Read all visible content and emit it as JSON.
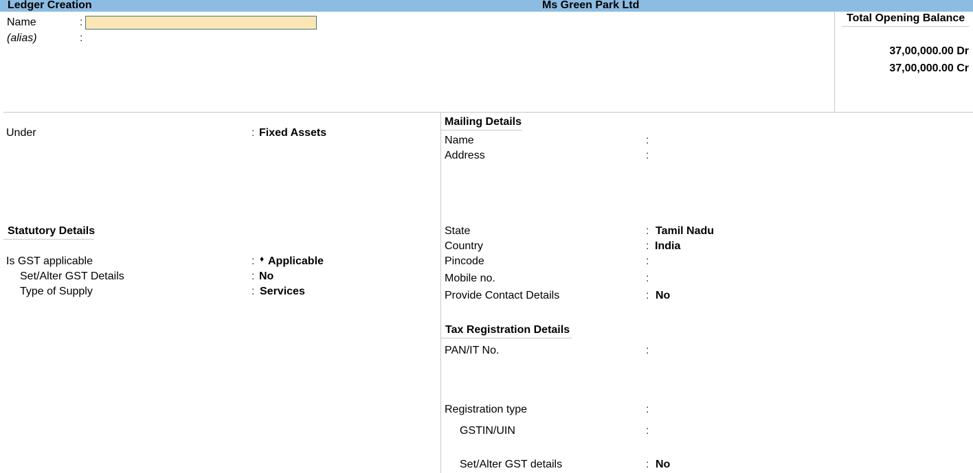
{
  "header": {
    "screen_title": "Ledger Creation",
    "company_name": "Ms Green Park Ltd"
  },
  "top": {
    "name_label": "Name",
    "name_value": "",
    "alias_label": "(alias)"
  },
  "opening_balance": {
    "title": "Total Opening Balance",
    "debit": "37,00,000.00 Dr",
    "credit": "37,00,000.00 Cr"
  },
  "left": {
    "under_label": "Under",
    "under_value": "Fixed Assets",
    "statutory_heading": "Statutory Details",
    "gst_applicable_label": "Is GST applicable",
    "gst_applicable_marker": "♦",
    "gst_applicable_value": "Applicable",
    "set_alter_gst_label": "Set/Alter GST Details",
    "set_alter_gst_value": "No",
    "type_of_supply_label": "Type of Supply",
    "type_of_supply_value": "Services"
  },
  "mailing": {
    "heading": "Mailing Details",
    "name_label": "Name",
    "name_value": "",
    "address_label": "Address",
    "address_value": "",
    "state_label": "State",
    "state_value": "Tamil Nadu",
    "country_label": "Country",
    "country_value": "India",
    "pincode_label": "Pincode",
    "pincode_value": "",
    "mobile_label": "Mobile no.",
    "mobile_value": "",
    "contact_label": "Provide Contact Details",
    "contact_value": "No"
  },
  "tax": {
    "heading": "Tax Registration Details",
    "pan_label": "PAN/IT No.",
    "pan_value": "",
    "reg_type_label": "Registration type",
    "reg_type_value": "",
    "gstin_label": "GSTIN/UIN",
    "gstin_value": "",
    "set_alter_label": "Set/Alter GST details",
    "set_alter_value": "No"
  },
  "separator": ":"
}
